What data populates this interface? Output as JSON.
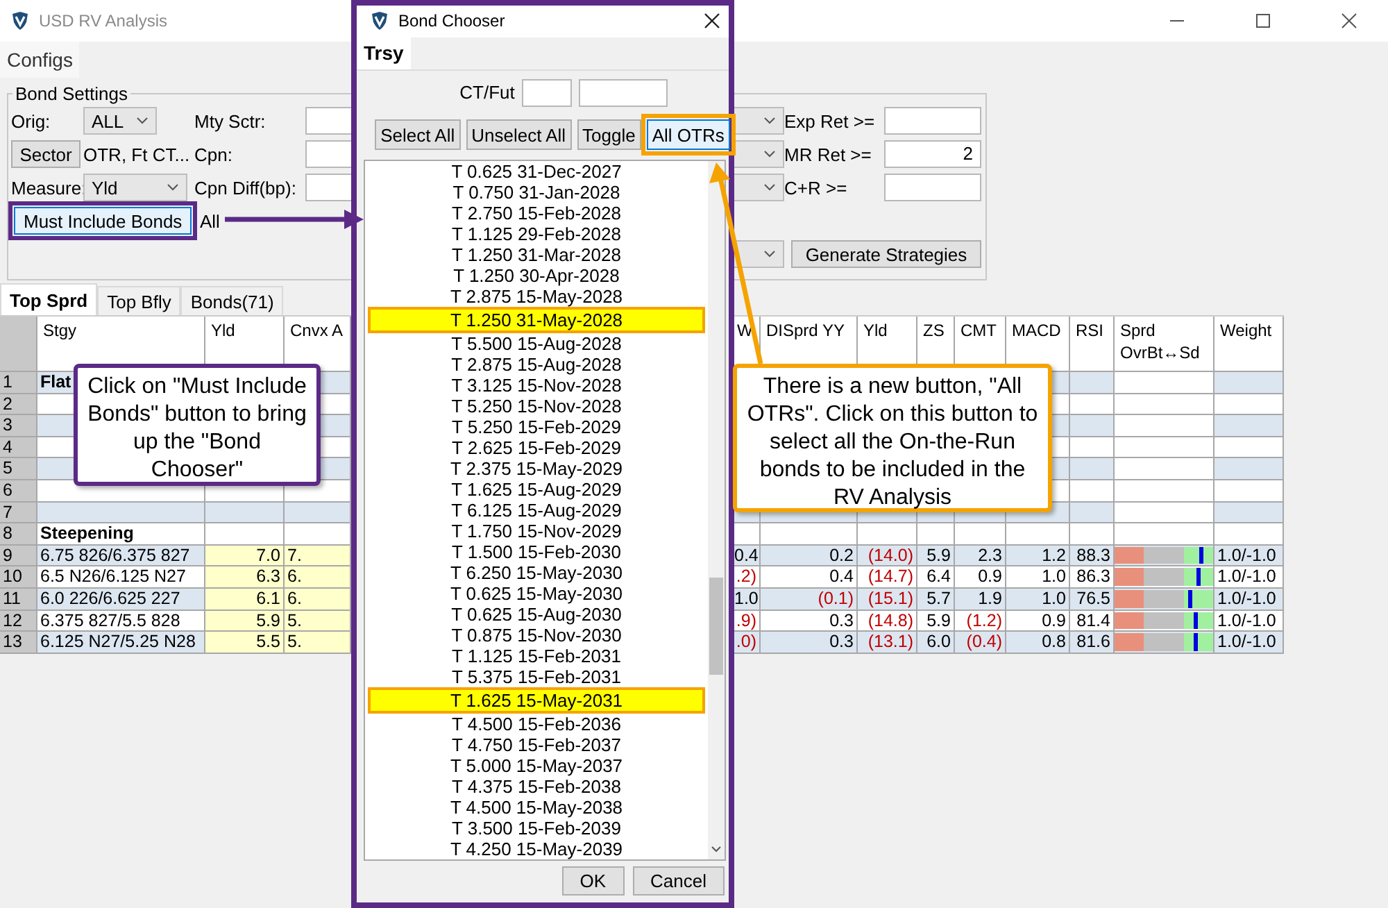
{
  "main_window": {
    "title": "USD RV Analysis",
    "menu": [
      {
        "label": "Configs"
      }
    ],
    "bond_settings": {
      "title": "Bond Settings",
      "orig_label": "Orig:",
      "orig_value": "ALL",
      "mty_sctr_label": "Mty Sctr:",
      "sector_button": "Sector",
      "sector_value": "OTR, Ft CT...",
      "cpn_label": "Cpn:",
      "measure_label": "Measure:",
      "measure_value": "Yld",
      "cpn_diff_label": "Cpn Diff(bp):",
      "must_include_button": "Must Include Bonds",
      "must_include_value": "All",
      "exp_ret_label": "Exp Ret >=",
      "mr_ret_label": "MR Ret >=",
      "mr_ret_value": "2",
      "c_r_label": "C+R >=",
      "generate_button": "Generate Strategies"
    },
    "tabs": [
      {
        "label": "Top Sprd",
        "selected": true
      },
      {
        "label": "Top Bfly",
        "selected": false
      },
      {
        "label": "Bonds(71)",
        "selected": false
      }
    ],
    "table": {
      "columns": [
        {
          "lines": [
            "Stgy"
          ],
          "kind": "text",
          "shaded": false
        },
        {
          "lines": [
            "Yld"
          ],
          "kind": "number",
          "shaded": true
        },
        {
          "lines": [
            "Cnvx A"
          ],
          "kind": "text",
          "shaded": true
        },
        {
          "lines": [
            "W"
          ],
          "kind": "number",
          "shaded": false
        },
        {
          "lines": [
            "DISprd YY"
          ],
          "kind": "number",
          "shaded": false
        },
        {
          "lines": [
            "Yld"
          ],
          "kind": "number",
          "shaded": false
        },
        {
          "lines": [
            "ZS"
          ],
          "kind": "number",
          "shaded": false
        },
        {
          "lines": [
            "CMT"
          ],
          "kind": "number",
          "shaded": false
        },
        {
          "lines": [
            "MACD"
          ],
          "kind": "number",
          "shaded": false
        },
        {
          "lines": [
            "RSI"
          ],
          "kind": "number",
          "shaded": false
        },
        {
          "lines": [
            "Sprd",
            "OvrBt↔Sd"
          ],
          "kind": "meter",
          "shaded": false
        },
        {
          "lines": [
            "Weight"
          ],
          "kind": "text",
          "shaded": false
        }
      ],
      "rows": [
        {
          "number": "1",
          "kind": "group",
          "label": "Flat"
        },
        {
          "number": "2",
          "kind": "empty"
        },
        {
          "number": "3",
          "kind": "empty"
        },
        {
          "number": "4",
          "kind": "empty"
        },
        {
          "number": "5",
          "kind": "empty"
        },
        {
          "number": "6",
          "kind": "empty"
        },
        {
          "number": "7",
          "kind": "empty"
        },
        {
          "number": "8",
          "kind": "group",
          "label": "Steepening"
        },
        {
          "number": "9",
          "kind": "data",
          "cells": [
            "6.75 826/6.375 827",
            "7.0",
            "7.",
            "0.4",
            "0.2",
            {
              "text": "(14.0)",
              "negative": true
            },
            "5.9",
            "2.3",
            "1.2",
            "88.3",
            {
              "level": 0.87
            },
            "1.0/-1.0"
          ]
        },
        {
          "number": "10",
          "kind": "data",
          "cells": [
            "6.5 N26/6.125 N27",
            "6.3",
            "6.",
            {
              "text": ".2)",
              "negative": true
            },
            "0.4",
            {
              "text": "(14.7)",
              "negative": true
            },
            "6.4",
            "0.9",
            "1.0",
            "86.3",
            {
              "level": 0.85
            },
            "1.0/-1.0"
          ]
        },
        {
          "number": "11",
          "kind": "data",
          "cells": [
            "6.0 226/6.625 227",
            "6.1",
            "6.",
            "1.0",
            {
              "text": "(0.1)",
              "negative": true
            },
            {
              "text": "(15.1)",
              "negative": true
            },
            "5.7",
            "1.9",
            "1.0",
            "76.5",
            {
              "level": 0.76
            },
            "1.0/-1.0"
          ]
        },
        {
          "number": "12",
          "kind": "data",
          "cells": [
            "6.375 827/5.5 828",
            "5.9",
            "5.",
            {
              "text": ".9)",
              "negative": true
            },
            "0.3",
            {
              "text": "(14.8)",
              "negative": true
            },
            "5.9",
            {
              "text": "(1.2)",
              "negative": true
            },
            "0.9",
            "81.4",
            {
              "level": 0.81
            },
            "1.0/-1.0"
          ]
        },
        {
          "number": "13",
          "kind": "data",
          "cells": [
            "6.125 N27/5.25 N28",
            "5.5",
            "5.",
            {
              "text": ".0)",
              "negative": true
            },
            "0.3",
            {
              "text": "(13.1)",
              "negative": true
            },
            "6.0",
            {
              "text": "(0.4)",
              "negative": true
            },
            "0.8",
            "81.6",
            {
              "level": 0.81
            },
            "1.0/-1.0"
          ]
        }
      ]
    }
  },
  "bond_chooser": {
    "title": "Bond Chooser",
    "tabs": [
      {
        "label": "Trsy",
        "selected": true
      }
    ],
    "ct_fut_label": "CT/Fut",
    "buttons": [
      {
        "label": "Select All",
        "focused": false
      },
      {
        "label": "Unselect All",
        "focused": false
      },
      {
        "label": "Toggle",
        "focused": false
      },
      {
        "label": "All OTRs",
        "focused": true
      }
    ],
    "bonds": [
      {
        "label": "T 0.625 31-Dec-2027",
        "selected": false
      },
      {
        "label": "T 0.750 31-Jan-2028",
        "selected": false
      },
      {
        "label": "T 2.750 15-Feb-2028",
        "selected": false
      },
      {
        "label": "T 1.125 29-Feb-2028",
        "selected": false
      },
      {
        "label": "T 1.250 31-Mar-2028",
        "selected": false
      },
      {
        "label": "T 1.250 30-Apr-2028",
        "selected": false
      },
      {
        "label": "T 2.875 15-May-2028",
        "selected": false
      },
      {
        "label": "T 1.250 31-May-2028",
        "selected": true
      },
      {
        "label": "T 5.500 15-Aug-2028",
        "selected": false
      },
      {
        "label": "T 2.875 15-Aug-2028",
        "selected": false
      },
      {
        "label": "T 3.125 15-Nov-2028",
        "selected": false
      },
      {
        "label": "T 5.250 15-Nov-2028",
        "selected": false
      },
      {
        "label": "T 5.250 15-Feb-2029",
        "selected": false
      },
      {
        "label": "T 2.625 15-Feb-2029",
        "selected": false
      },
      {
        "label": "T 2.375 15-May-2029",
        "selected": false
      },
      {
        "label": "T 1.625 15-Aug-2029",
        "selected": false
      },
      {
        "label": "T 6.125 15-Aug-2029",
        "selected": false
      },
      {
        "label": "T 1.750 15-Nov-2029",
        "selected": false
      },
      {
        "label": "T 1.500 15-Feb-2030",
        "selected": false
      },
      {
        "label": "T 6.250 15-May-2030",
        "selected": false
      },
      {
        "label": "T 0.625 15-May-2030",
        "selected": false
      },
      {
        "label": "T 0.625 15-Aug-2030",
        "selected": false
      },
      {
        "label": "T 0.875 15-Nov-2030",
        "selected": false
      },
      {
        "label": "T 1.125 15-Feb-2031",
        "selected": false
      },
      {
        "label": "T 5.375 15-Feb-2031",
        "selected": false
      },
      {
        "label": "T 1.625 15-May-2031",
        "selected": true
      },
      {
        "label": "T 4.500 15-Feb-2036",
        "selected": false
      },
      {
        "label": "T 4.750 15-Feb-2037",
        "selected": false
      },
      {
        "label": "T 5.000 15-May-2037",
        "selected": false
      },
      {
        "label": "T 4.375 15-Feb-2038",
        "selected": false
      },
      {
        "label": "T 4.500 15-May-2038",
        "selected": false
      },
      {
        "label": "T 3.500 15-Feb-2039",
        "selected": false
      },
      {
        "label": "T 4.250 15-May-2039",
        "selected": false
      }
    ],
    "footer_buttons": [
      "OK",
      "Cancel"
    ]
  },
  "annotations": [
    {
      "kind": "callout",
      "color": "#5b2a86",
      "text": "Click on \"Must Include Bonds\" button to bring up the \"Bond Chooser\""
    },
    {
      "kind": "callout",
      "color": "#f5a300",
      "text": "There is a new button, \"All OTRs\". Click on this button to select all the On-the-Run bonds to be included in the RV Analysis"
    }
  ]
}
